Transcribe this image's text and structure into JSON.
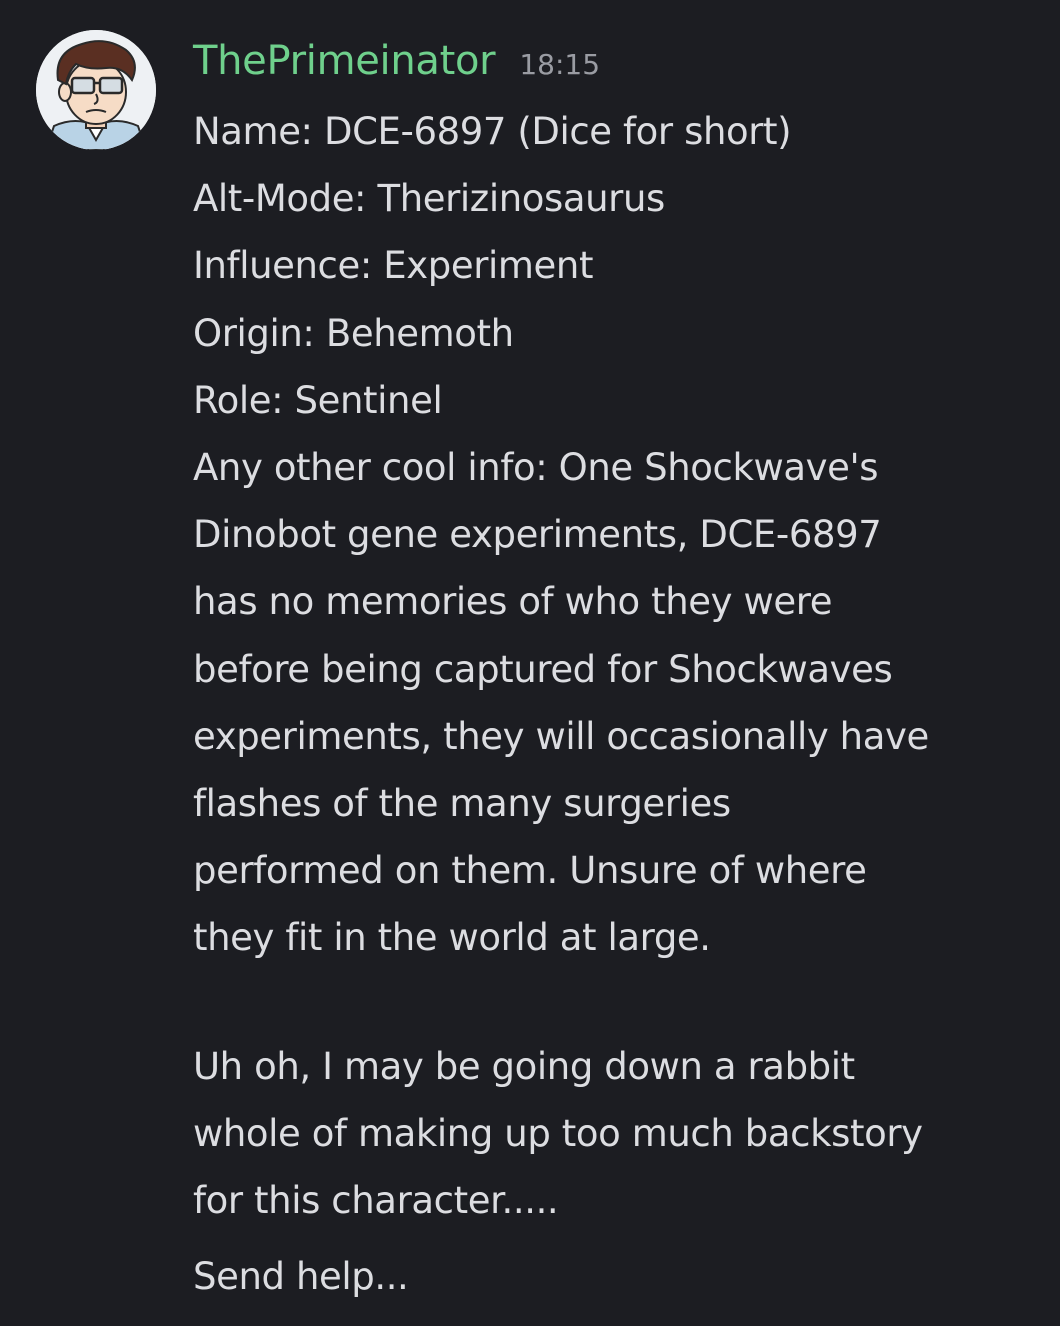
{
  "message": {
    "author": "ThePrimeinator",
    "timestamp": "18:15",
    "avatar": "cartoon-man-with-sunglasses-avatar",
    "colors": {
      "background": "#1c1d22",
      "username": "#6fd08c",
      "text": "#dcdde1",
      "timestamp": "#9a9ca3"
    },
    "first_block_lines": [
      "Name: DCE-6897 (Dice for short)",
      "Alt-Mode: Therizinosaurus",
      "Influence: Experiment",
      "Origin: Behemoth",
      "Role: Sentinel",
      "Any other cool info: One Shockwave's",
      "Dinobot gene experiments, DCE-6897",
      "has no memories of who they were",
      "before being captured for Shockwaves",
      "experiments, they will occasionally have",
      "flashes of the many surgeries",
      "performed on them. Unsure of where",
      "they fit in the world at large."
    ],
    "second_block_lines": [
      "Uh oh, I may be going down a rabbit",
      "whole of making up too much backstory",
      "for this character....."
    ],
    "followup": "Send help..."
  }
}
